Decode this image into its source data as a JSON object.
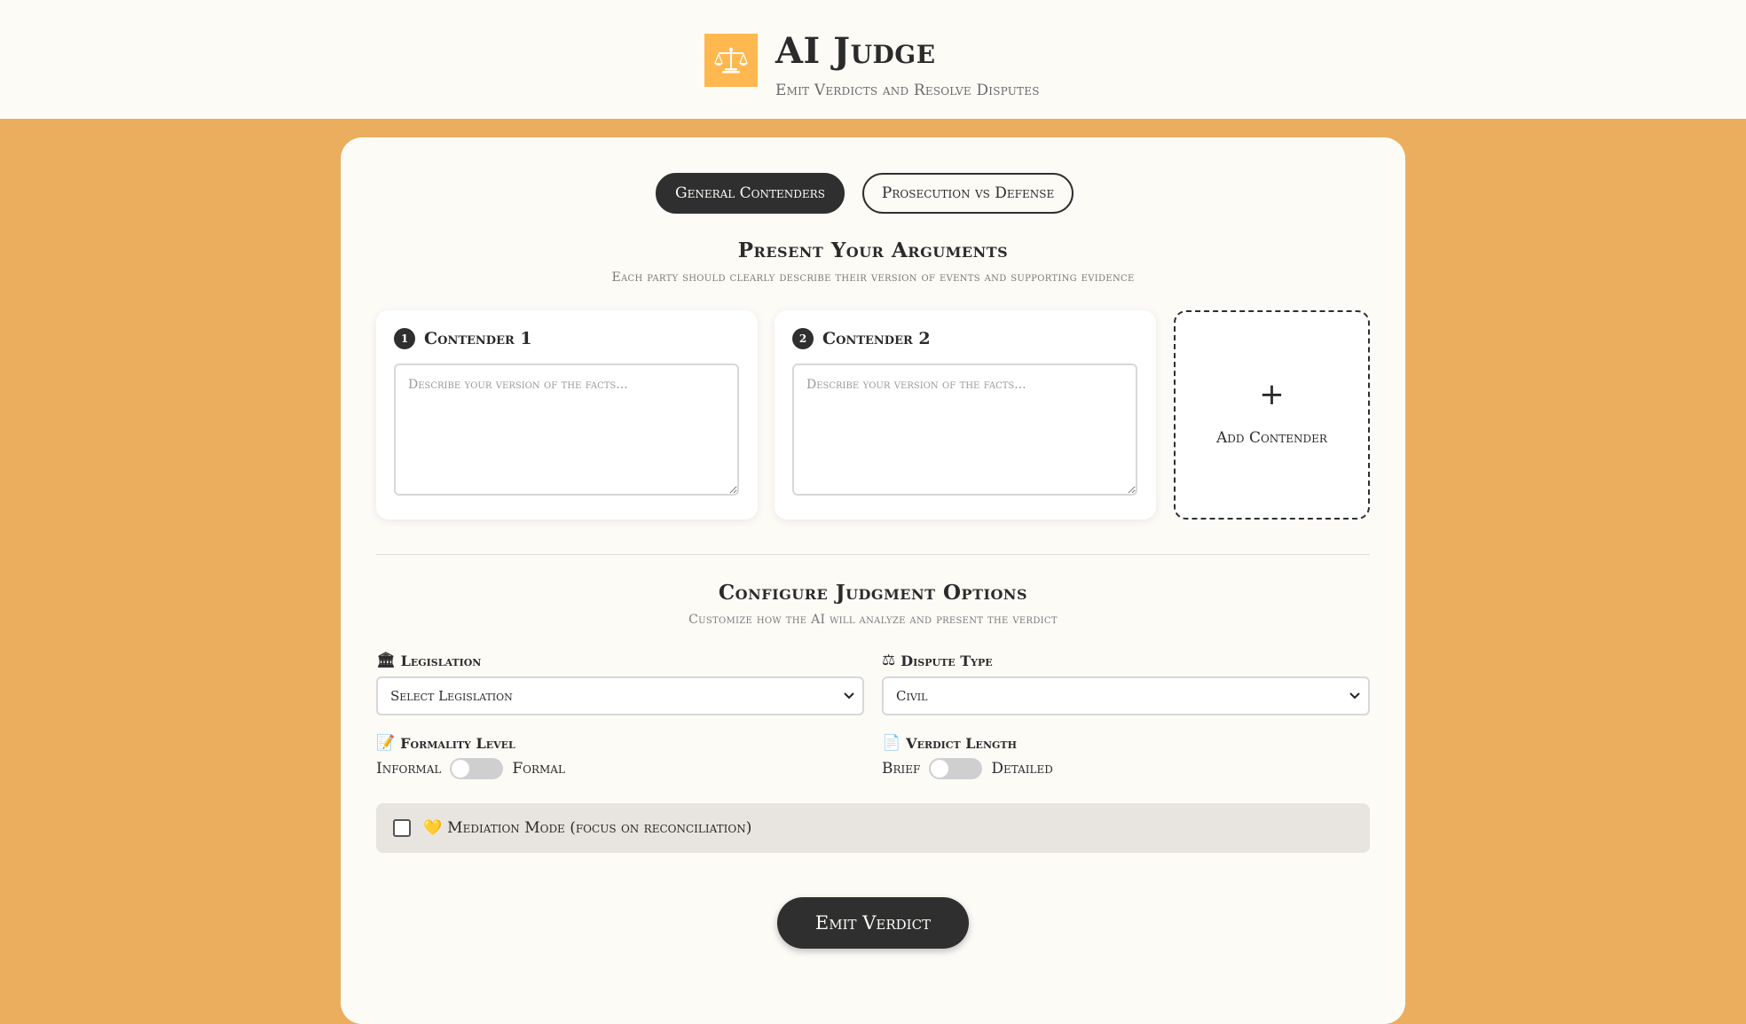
{
  "header": {
    "title": "AI Judge",
    "subtitle": "Emit Verdicts and Resolve Disputes",
    "logo_icon": "scales-of-justice-icon"
  },
  "mode_tabs": [
    {
      "label": "General Contenders",
      "active": true
    },
    {
      "label": "Prosecution vs Defense",
      "active": false
    }
  ],
  "arguments": {
    "title": "Present Your Arguments",
    "subtitle": "Each party should clearly describe their version of events and supporting evidence",
    "contenders": [
      {
        "number": "1",
        "name": "Contender 1",
        "placeholder": "Describe your version of the facts...",
        "value": ""
      },
      {
        "number": "2",
        "name": "Contender 2",
        "placeholder": "Describe your version of the facts...",
        "value": ""
      }
    ],
    "add_label": "Add Contender",
    "add_icon": "+"
  },
  "options": {
    "title": "Configure Judgment Options",
    "subtitle": "Customize how the AI will analyze and present the verdict",
    "legislation": {
      "label": "Legislation",
      "icon": "🏛",
      "selected": "Select Legislation"
    },
    "dispute_type": {
      "label": "Dispute Type",
      "icon": "⚖",
      "selected": "Civil"
    },
    "formality": {
      "label": "Formality Level",
      "icon": "📝",
      "left": "Informal",
      "right": "Formal",
      "on": false
    },
    "verdict_length": {
      "label": "Verdict Length",
      "icon": "📄",
      "left": "Brief",
      "right": "Detailed",
      "on": false
    },
    "mediation": {
      "label": "Mediation Mode (focus on reconciliation)",
      "icon": "💛",
      "checked": false
    }
  },
  "emit_button": "Emit Verdict",
  "colors": {
    "background": "#ebae5e",
    "accent": "#ffb84f",
    "dark": "#2f2f2f",
    "card": "#fdfbf6"
  }
}
